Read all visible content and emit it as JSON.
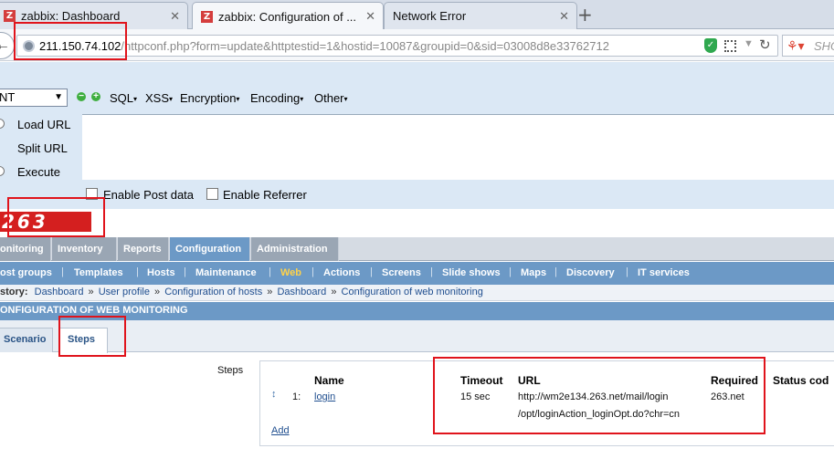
{
  "browser": {
    "tabs": [
      {
        "title": "zabbix: Dashboard",
        "icon": "zabbix-favicon",
        "close": "✕"
      },
      {
        "title": "zabbix: Configuration of ...",
        "icon": "zabbix-favicon",
        "close": "✕"
      },
      {
        "title": "Network Error",
        "icon": "",
        "close": "✕"
      }
    ],
    "new_tab": "+",
    "address": {
      "host": "211.150.74.102",
      "path": "/httpconf.php?form=update&httptestid=1&hostid=10087&groupid=0&sid=03008d8e33762712"
    },
    "search_placeholder": "SHO"
  },
  "hackbar": {
    "select_value": "NT",
    "menus": [
      "SQL",
      "XSS",
      "Encryption",
      "Encoding",
      "Other"
    ],
    "actions": [
      "Load URL",
      "Split URL",
      "Execute"
    ],
    "checkboxes": [
      "Enable Post data",
      "Enable Referrer"
    ]
  },
  "zabbix": {
    "logo": "263",
    "main_menu": [
      "onitoring",
      "Inventory",
      "Reports",
      "Configuration",
      "Administration"
    ],
    "sub_menu": [
      "ost groups",
      "Templates",
      "Hosts",
      "Maintenance",
      "Web",
      "Actions",
      "Screens",
      "Slide shows",
      "Maps",
      "Discovery",
      "IT services"
    ],
    "history": {
      "label": "story:",
      "items": [
        "Dashboard",
        "User profile",
        "Configuration of hosts",
        "Dashboard",
        "Configuration of web monitoring"
      ],
      "separator": "»"
    },
    "page_title": "ONFIGURATION OF WEB MONITORING",
    "tabs": [
      "Scenario",
      "Steps"
    ],
    "steps": {
      "label": "Steps",
      "headers": [
        "Name",
        "Timeout",
        "URL",
        "Required",
        "Status cod"
      ],
      "rows": [
        {
          "num": "1:",
          "name": "login",
          "timeout": "15 sec",
          "url_line1": "http://wm2e134.263.net/mail/login",
          "url_line2": "/opt/loginAction_loginOpt.do?chr=cn",
          "required": "263.net"
        }
      ],
      "add": "Add"
    }
  },
  "colors": {
    "annotation": "#e0141c",
    "accent": "#6c99c6",
    "logo": "#d41f1f",
    "active_submenu": "#ffd24a"
  }
}
